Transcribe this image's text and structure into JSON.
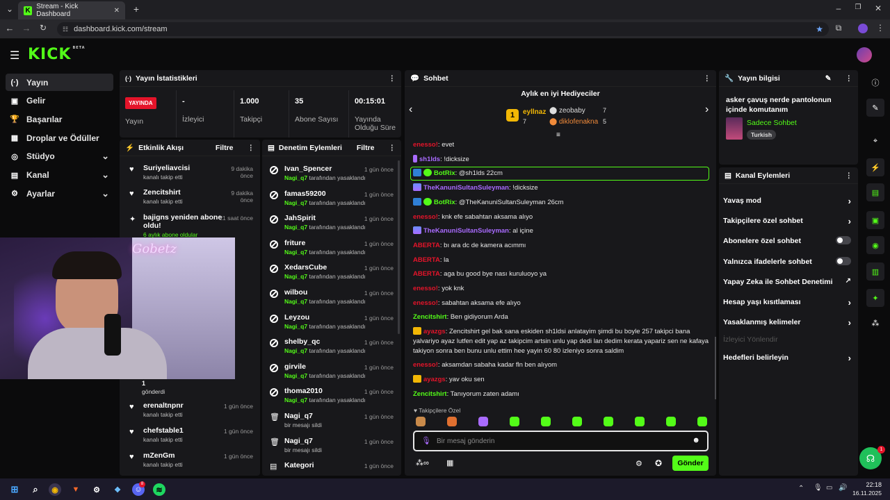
{
  "browser": {
    "tab_title": "Stream - Kick Dashboard",
    "url": "dashboard.kick.com/stream"
  },
  "brand": {
    "logo": "KICK",
    "beta": "BETA",
    "accent": "#53fc18"
  },
  "nav": {
    "items": [
      {
        "label": "Yayın",
        "icon": "broadcast-icon",
        "active": true
      },
      {
        "label": "Gelir",
        "icon": "revenue-icon"
      },
      {
        "label": "Başarılar",
        "icon": "trophy-icon"
      },
      {
        "label": "Droplar ve Ödüller",
        "icon": "gift-icon"
      },
      {
        "label": "Stüdyo",
        "icon": "studio-icon",
        "expand": true
      },
      {
        "label": "Kanal",
        "icon": "channel-icon",
        "expand": true
      },
      {
        "label": "Ayarlar",
        "icon": "gear-icon",
        "expand": true
      }
    ]
  },
  "stats": {
    "title": "Yayın İstatistikleri",
    "live_badge": "YAYINDA",
    "live_label": "Yayın",
    "items": [
      {
        "value": "-",
        "label": "İzleyici"
      },
      {
        "value": "1.000",
        "label": "Takipçi"
      },
      {
        "value": "35",
        "label": "Abone Sayısı"
      },
      {
        "value": "00:15:01",
        "label": "Yayında Olduğu Süre"
      }
    ]
  },
  "events": {
    "title": "Etkinlik Akışı",
    "filter": "Filtre",
    "items": [
      {
        "name": "Suriyeliavcisi",
        "sub": "kanalı takip etti",
        "time": "9 dakika önce"
      },
      {
        "name": "Zencitshirt",
        "sub": "kanalı takip etti",
        "time": "9 dakika önce"
      },
      {
        "name": "bajigns yeniden abone oldu!",
        "sub": "6 aylık abone oldular",
        "time": "21 saat önce"
      },
      {
        "name": "1",
        "sub": "gönderdi",
        "time": ""
      },
      {
        "name": "erenaltnpnr",
        "sub": "kanalı takip etti",
        "time": "1 gün önce"
      },
      {
        "name": "chefstable1",
        "sub": "kanalı takip etti",
        "time": "1 gün önce"
      },
      {
        "name": "mZenGm",
        "sub": "kanalı takip etti",
        "time": "1 gün önce"
      }
    ]
  },
  "moderation": {
    "title": "Denetim Eylemleri",
    "filter": "Filtre",
    "items": [
      {
        "name": "Ivan_Spencer",
        "by": "Nagi_q7",
        "sub": "tarafından yasaklandı",
        "time": "1 gün önce"
      },
      {
        "name": "famas59200",
        "by": "Nagi_q7",
        "sub": "tarafından yasaklandı",
        "time": "1 gün önce"
      },
      {
        "name": "JahSpirit",
        "by": "Nagi_q7",
        "sub": "tarafından yasaklandı",
        "time": "1 gün önce"
      },
      {
        "name": "friture",
        "by": "Nagi_q7",
        "sub": "tarafından yasaklandı",
        "time": "1 gün önce"
      },
      {
        "name": "XedarsCube",
        "by": "Nagi_q7",
        "sub": "tarafından yasaklandı",
        "time": "1 gün önce"
      },
      {
        "name": "wilbou",
        "by": "Nagi_q7",
        "sub": "tarafından yasaklandı",
        "time": "1 gün önce"
      },
      {
        "name": "Leyzou",
        "by": "Nagi_q7",
        "sub": "tarafından yasaklandı",
        "time": "1 gün önce"
      },
      {
        "name": "shelby_qc",
        "by": "Nagi_q7",
        "sub": "tarafından yasaklandı",
        "time": "1 gün önce"
      },
      {
        "name": "girvile",
        "by": "Nagi_q7",
        "sub": "tarafından yasaklandı",
        "time": "1 gün önce"
      },
      {
        "name": "thoma2010",
        "by": "Nagi_q7",
        "sub": "tarafından yasaklandı",
        "time": "1 gün önce"
      },
      {
        "name": "Nagi_q7",
        "by": "",
        "sub": "bir mesajı sildi",
        "time": "1 gün önce"
      },
      {
        "name": "Nagi_q7",
        "by": "",
        "sub": "bir mesajı sildi",
        "time": "1 gün önce"
      },
      {
        "name": "Kategori",
        "by": "",
        "sub": "",
        "time": "1 gün önce"
      }
    ]
  },
  "chat": {
    "title": "Sohbet",
    "gifters_title": "Aylık en iyi Hediyeciler",
    "gifters": [
      {
        "rank": "1",
        "name": "eyllnaz",
        "count": "7"
      },
      {
        "name": "zeobaby",
        "count": "7"
      },
      {
        "name": "diklofenakna",
        "count": "5"
      }
    ],
    "messages": [
      {
        "user": "enesso!",
        "text": "evet",
        "color": "#e5142a"
      },
      {
        "user": "sh1lds",
        "text": "!dicksize",
        "color": "#a96bff"
      },
      {
        "user": "BotRix",
        "text": "@sh1lds 22cm",
        "color": "#53fc18",
        "highlight": true
      },
      {
        "user": "TheKanuniSultanSuleyman",
        "text": "!dicksize",
        "color": "#a96bff"
      },
      {
        "user": "BotRix",
        "text": "@TheKanuniSultanSuleyman 26cm",
        "color": "#53fc18"
      },
      {
        "user": "enesso!",
        "text": "knk efe sabahtan aksama alıyo",
        "color": "#e5142a"
      },
      {
        "user": "TheKanuniSultanSuleyman",
        "text": "al içine",
        "color": "#a96bff"
      },
      {
        "user": "ABERTA",
        "text": "bı ara dc de kamera acımmı",
        "color": "#e5142a"
      },
      {
        "user": "ABERTA",
        "text": "la",
        "color": "#e5142a"
      },
      {
        "user": "ABERTA",
        "text": "aga bu good bye nası kuruluoyo ya",
        "color": "#e5142a"
      },
      {
        "user": "enesso!",
        "text": "yok knk",
        "color": "#e5142a"
      },
      {
        "user": "enesso!",
        "text": "sabahtan aksama efe alıyo",
        "color": "#e5142a"
      },
      {
        "user": "Zencitshirt",
        "text": "Ben gidiyorum Arda",
        "color": "#53fc18"
      },
      {
        "user": "ayazgs",
        "text": "Zencitshirt gel bak sana eskiden sh1ldsi anlatayim şimdi bu boyle 257 takipci bana yalvariyo ayaz lutfen edit yap az takipcim artsin unlu yap dedi lan dedim kerata yapariz sen ne kafaya takiyon sonra ben bunu unlu ettim hee yayin 60 80 izleniyo sonra saldim",
        "color": "#e5142a"
      },
      {
        "user": "enesso!",
        "text": "aksamdan sabaha kadar fln ben alıyom",
        "color": "#e5142a"
      },
      {
        "user": "ayazgs",
        "text": "yav oku sen",
        "color": "#e5142a"
      },
      {
        "user": "Zencitshirt",
        "text": "Tanıyorum zaten adamı",
        "color": "#53fc18"
      }
    ],
    "followers_only": "Takipçilere Özel",
    "placeholder": "Bir mesaj gönderin",
    "send": "Gönder"
  },
  "stream_info": {
    "title": "Yayın bilgisi",
    "stream_title": "asker çavuş nerde pantolonun içinde komutanım",
    "category": "Sadece Sohbet",
    "language": "Turkish"
  },
  "channel_actions": {
    "title": "Kanal Eylemleri",
    "items": [
      {
        "label": "Yavaş mod",
        "type": "arrow"
      },
      {
        "label": "Takipçilere özel sohbet",
        "type": "arrow"
      },
      {
        "label": "Abonelere özel sohbet",
        "type": "toggle"
      },
      {
        "label": "Yalnızca ifadelerle sohbet",
        "type": "toggle"
      },
      {
        "label": "Yapay Zeka ile Sohbet Denetimi",
        "type": "external"
      },
      {
        "label": "Hesap yaşı kısıtlaması",
        "type": "arrow"
      },
      {
        "label": "Yasaklanmış kelimeler",
        "type": "arrow"
      },
      {
        "label": "İzleyici Yönlendir",
        "type": "disabled"
      },
      {
        "label": "Hedefleri belirleyin",
        "type": "arrow"
      }
    ]
  },
  "overlay": {
    "neon_text": "Gobetz"
  },
  "support": {
    "badge": "1"
  },
  "taskbar": {
    "time": "22:18",
    "date": "16.11.2025",
    "badge": "8"
  }
}
